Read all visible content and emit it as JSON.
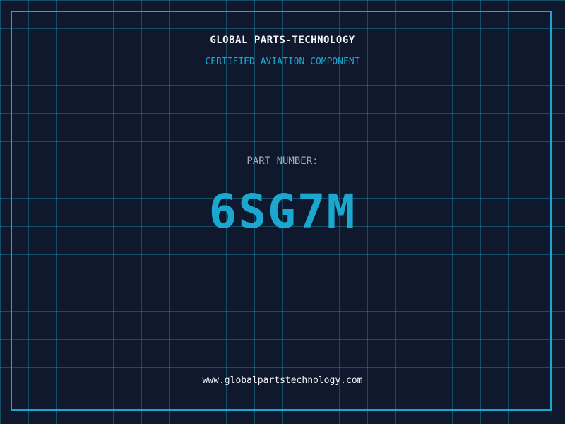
{
  "brand": {
    "name": "GLOBAL PARTS-TECHNOLOGY",
    "tagline": "CERTIFIED AVIATION COMPONENT"
  },
  "part": {
    "label": "PART NUMBER:",
    "number": "6SG7M"
  },
  "footer": {
    "website": "www.globalpartstechnology.com"
  },
  "colors": {
    "background": "#0f182c",
    "accent": "#1ba8d0",
    "text_primary": "#f2f4f7",
    "text_secondary": "#a7adb8"
  }
}
